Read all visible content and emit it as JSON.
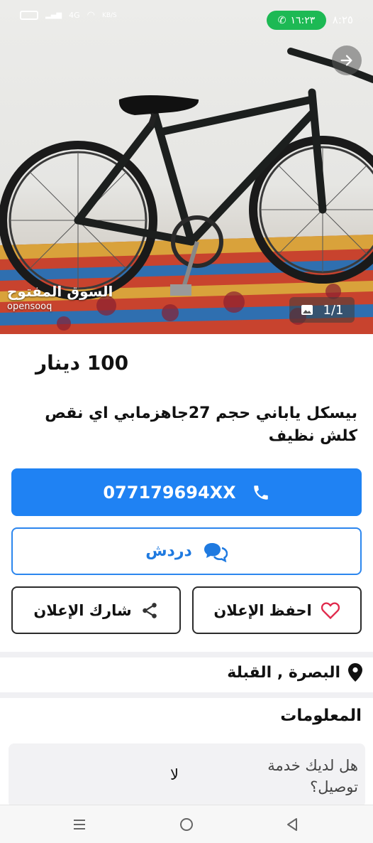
{
  "status_bar": {
    "network": "4G",
    "speed": "KB/S",
    "call_duration": "١٦:٢٣",
    "time": "٨:٢٥"
  },
  "gallery": {
    "counter": "1/1",
    "watermark_ar": "السوق المفتوح",
    "watermark_en": "opensooq"
  },
  "listing": {
    "price": "100 دينار",
    "title": "بيسكل ياباني حجم 27جاهزمابي اي نقص كلش نظيف"
  },
  "actions": {
    "call_number": "077179694XX",
    "chat_label": "دردش",
    "save_label": "احفظ الإعلان",
    "share_label": "شارك الإعلان"
  },
  "location": {
    "text": "البصرة , القبلة"
  },
  "info": {
    "section_title": "المعلومات",
    "rows": [
      {
        "key": "هل لديك خدمة توصيل؟",
        "value": "لا"
      }
    ]
  },
  "icons": {
    "share": "share-arrow-icon",
    "gallery": "image-icon",
    "phone": "phone-icon",
    "chat": "chat-bubbles-icon",
    "heart": "heart-outline-icon",
    "share_nodes": "share-nodes-icon",
    "pin": "location-pin-icon"
  },
  "colors": {
    "primary": "#1f82f3",
    "chat_border": "#2c86ee",
    "call_pill": "#1db954",
    "heart": "#e0284b"
  }
}
